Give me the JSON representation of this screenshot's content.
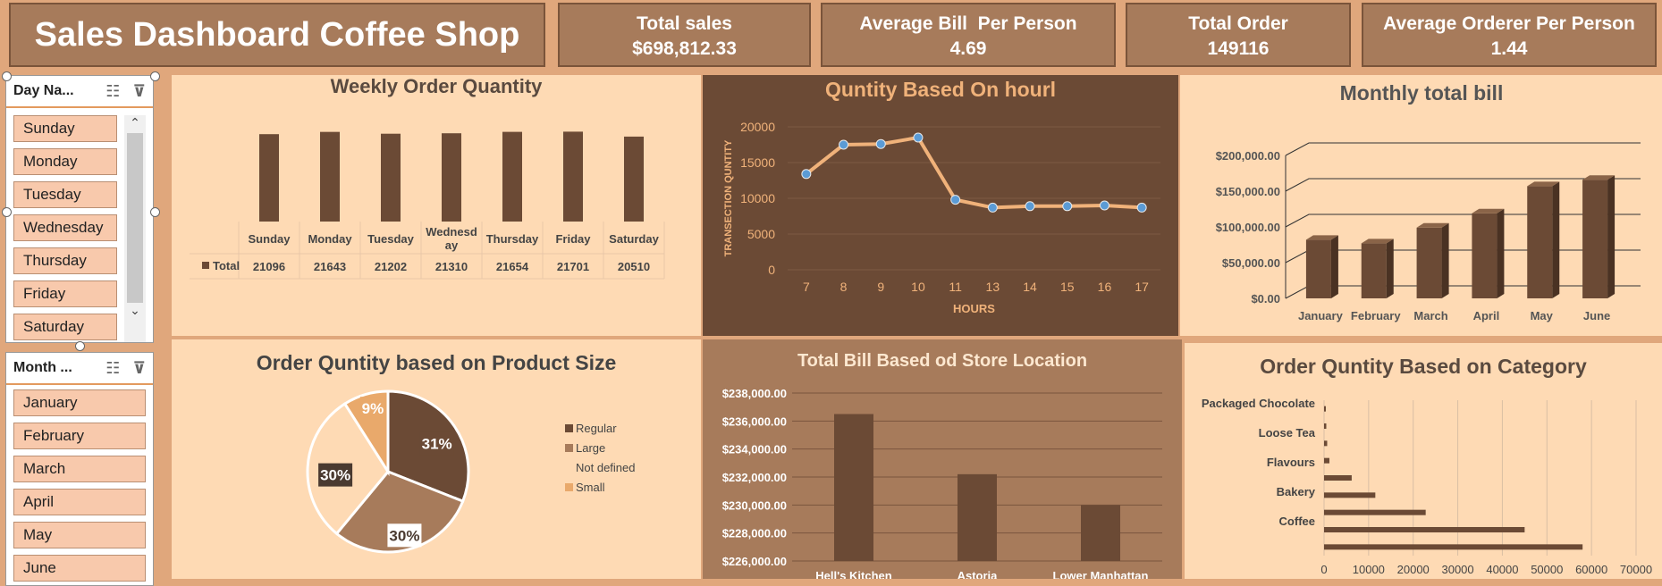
{
  "dashboard": {
    "title": "Sales Dashboard Coffee Shop"
  },
  "kpis": [
    {
      "title": "Total sales",
      "value": "$698,812.33"
    },
    {
      "title": "Average Bill  Per Person",
      "value": "4.69"
    },
    {
      "title": "Total Order",
      "value": "149116"
    },
    {
      "title": "Average Orderer Per Person",
      "value": "1.44"
    }
  ],
  "slicer_day": {
    "header": "Day Na...",
    "items": [
      "Sunday",
      "Monday",
      "Tuesday",
      "Wednesday",
      "Thursday",
      "Friday",
      "Saturday"
    ]
  },
  "slicer_month": {
    "header": "Month ...",
    "items": [
      "January",
      "February",
      "March",
      "April",
      "May",
      "June"
    ]
  },
  "colors": {
    "dark": "#6b4a35",
    "mid": "#a77b5b",
    "light": "#fedab4",
    "orange": "#e9a96b",
    "line": "#f0b27a"
  },
  "chart_data": [
    {
      "type": "bar",
      "title": "Weekly Order Quantity",
      "categories": [
        "Sunday",
        "Monday",
        "Tuesday",
        "Wednesd ay",
        "Thursday",
        "Friday",
        "Saturday"
      ],
      "series": [
        {
          "name": "Total",
          "values": [
            21096,
            21643,
            21202,
            21310,
            21654,
            21701,
            20510
          ]
        }
      ],
      "data_table": true,
      "legend": "none"
    },
    {
      "type": "line",
      "title": "Quntity Based On hourl",
      "xlabel": "HOURS",
      "ylabel": "TRANSECTION QUNTITY",
      "x": [
        7,
        8,
        9,
        10,
        11,
        13,
        14,
        15,
        16,
        17
      ],
      "values": [
        13400,
        17500,
        17600,
        18500,
        9800,
        8700,
        8900,
        8900,
        9000,
        8700
      ],
      "yticks": [
        0,
        5000,
        10000,
        15000,
        20000
      ],
      "ylim": [
        0,
        20000
      ],
      "grid": true
    },
    {
      "type": "bar",
      "title": "Monthly total bill",
      "categories": [
        "January",
        "February",
        "March",
        "April",
        "May",
        "June"
      ],
      "values": [
        82000,
        77000,
        99000,
        119000,
        157000,
        166000
      ],
      "yticks": [
        "$0.00",
        "$50,000.00",
        "$100,000.00",
        "$150,000.00",
        "$200,000.00"
      ],
      "ylim": [
        0,
        200000
      ],
      "grid": true,
      "style": "3d"
    },
    {
      "type": "pie",
      "title": "Order Quntity based on Product Size",
      "slices": [
        {
          "name": "Regular",
          "value": 31,
          "label": "31%"
        },
        {
          "name": "Large",
          "value": 30,
          "label": "30%"
        },
        {
          "name": "Not defined",
          "value": 30,
          "label": "30%"
        },
        {
          "name": "Small",
          "value": 9,
          "label": "9%"
        }
      ],
      "legend": "right"
    },
    {
      "type": "bar",
      "title": "Total Bill Based od Store Location",
      "categories": [
        "Hell's Kitchen",
        "Astoria",
        "Lower Manhattan"
      ],
      "values": [
        236500,
        232200,
        230000
      ],
      "yticks": [
        "$226,000.00",
        "$228,000.00",
        "$230,000.00",
        "$232,000.00",
        "$234,000.00",
        "$236,000.00",
        "$238,000.00"
      ],
      "ylim": [
        226000,
        238000
      ],
      "grid": true
    },
    {
      "type": "bar",
      "orientation": "horizontal",
      "title": "Order Quntity Based on Category",
      "category_labels": [
        "Packaged Chocolate",
        "Loose Tea",
        "Flavours",
        "Bakery",
        "Coffee"
      ],
      "values": [
        400,
        500,
        700,
        1200,
        6200,
        11500,
        22800,
        45000,
        58000
      ],
      "xticks": [
        "0",
        "10000",
        "20000",
        "30000",
        "40000",
        "50000",
        "60000",
        "70000"
      ],
      "xlim": [
        0,
        70000
      ],
      "grid": true
    }
  ]
}
